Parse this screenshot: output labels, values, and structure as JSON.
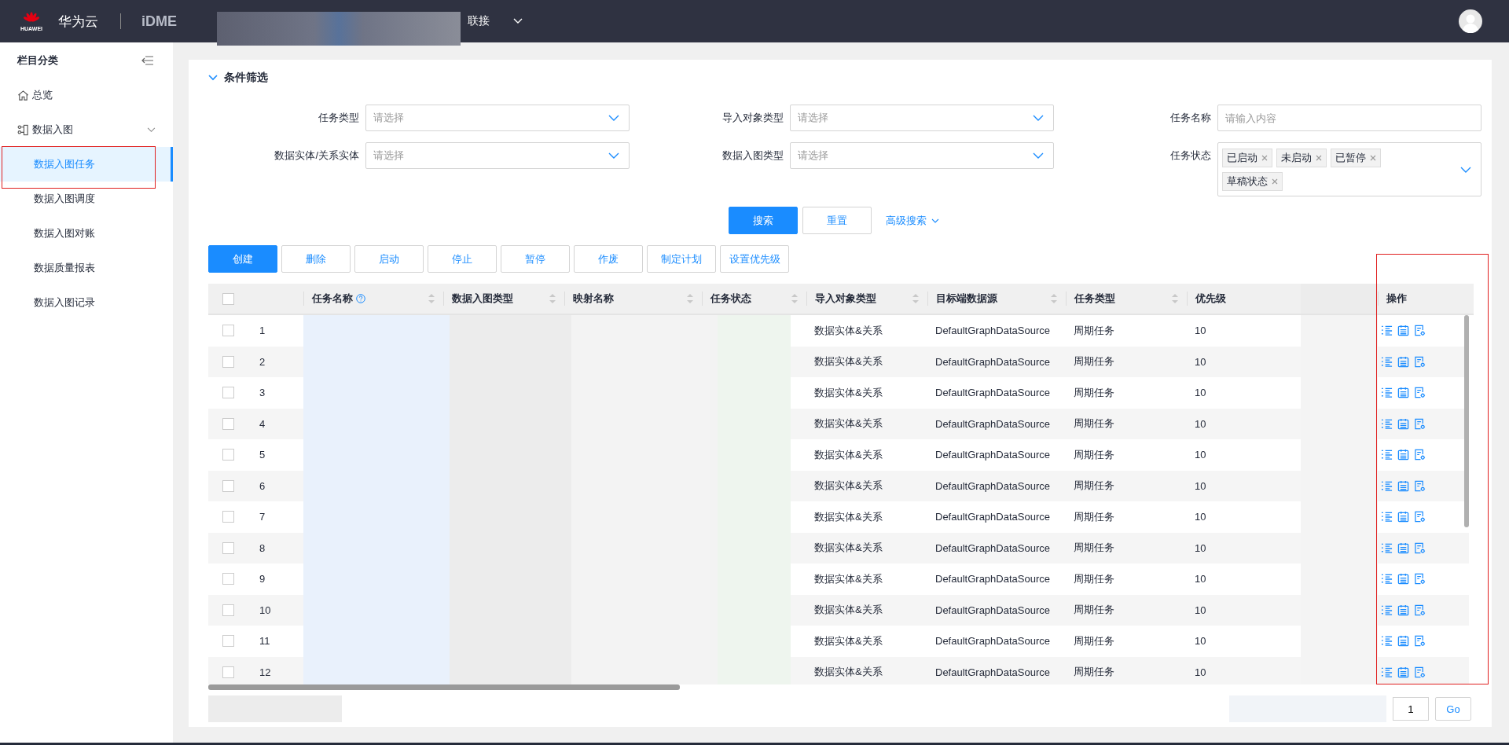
{
  "header": {
    "logo_text": "HUAWEI",
    "brand": "华为云",
    "product": "iDME",
    "project_suffix": "联接"
  },
  "sidebar": {
    "title": "栏目分类",
    "items": [
      {
        "label": "总览",
        "selected": false
      },
      {
        "label": "数据入图",
        "selected": false,
        "expanded": true,
        "children": [
          {
            "label": "数据入图任务",
            "selected": true
          },
          {
            "label": "数据入图调度",
            "selected": false
          },
          {
            "label": "数据入图对账",
            "selected": false
          },
          {
            "label": "数据质量报表",
            "selected": false
          },
          {
            "label": "数据入图记录",
            "selected": false
          }
        ]
      }
    ]
  },
  "filter": {
    "title": "条件筛选",
    "expanded": true,
    "fields": [
      {
        "label": "任务类型",
        "kind": "select",
        "placeholder": "请选择"
      },
      {
        "label": "导入对象类型",
        "kind": "select",
        "placeholder": "请选择"
      },
      {
        "label": "任务名称",
        "kind": "input",
        "placeholder": "请输入内容"
      },
      {
        "label": "数据实体/关系实体",
        "kind": "select",
        "placeholder": "请选择"
      },
      {
        "label": "数据入图类型",
        "kind": "select",
        "placeholder": "请选择"
      },
      {
        "label": "任务状态",
        "kind": "tags",
        "tags": [
          "已启动",
          "未启动",
          "已暂停",
          "草稿状态"
        ]
      }
    ],
    "search_button": "搜索",
    "reset_button": "重置",
    "advanced_link": "高级搜索"
  },
  "toolbar": [
    {
      "label": "创建",
      "primary": true
    },
    {
      "label": "删除",
      "primary": false
    },
    {
      "label": "启动",
      "primary": false
    },
    {
      "label": "停止",
      "primary": false
    },
    {
      "label": "暂停",
      "primary": false
    },
    {
      "label": "作废",
      "primary": false
    },
    {
      "label": "制定计划",
      "primary": false
    },
    {
      "label": "设置优先级",
      "primary": false
    }
  ],
  "table": {
    "all_checked": false,
    "columns": [
      {
        "label": "任务名称",
        "help": true,
        "sortable": true
      },
      {
        "label": "数据入图类型",
        "help": false,
        "sortable": true
      },
      {
        "label": "映射名称",
        "help": false,
        "sortable": true
      },
      {
        "label": "任务状态",
        "help": false,
        "sortable": true
      },
      {
        "label": "导入对象类型",
        "help": false,
        "sortable": true
      },
      {
        "label": "目标端数据源",
        "help": false,
        "sortable": true
      },
      {
        "label": "任务类型",
        "help": false,
        "sortable": true
      },
      {
        "label": "优先级",
        "help": false,
        "sortable": false
      },
      {
        "label": "操作",
        "help": false,
        "sortable": false
      }
    ],
    "rows": [
      {
        "index": "1",
        "checked": false,
        "import_type": "数据实体&关系",
        "datasource": "DefaultGraphDataSource",
        "task_type": "周期任务",
        "priority": "10"
      },
      {
        "index": "2",
        "checked": false,
        "import_type": "数据实体&关系",
        "datasource": "DefaultGraphDataSource",
        "task_type": "周期任务",
        "priority": "10"
      },
      {
        "index": "3",
        "checked": false,
        "import_type": "数据实体&关系",
        "datasource": "DefaultGraphDataSource",
        "task_type": "周期任务",
        "priority": "10"
      },
      {
        "index": "4",
        "checked": false,
        "import_type": "数据实体&关系",
        "datasource": "DefaultGraphDataSource",
        "task_type": "周期任务",
        "priority": "10"
      },
      {
        "index": "5",
        "checked": false,
        "import_type": "数据实体&关系",
        "datasource": "DefaultGraphDataSource",
        "task_type": "周期任务",
        "priority": "10"
      },
      {
        "index": "6",
        "checked": false,
        "import_type": "数据实体&关系",
        "datasource": "DefaultGraphDataSource",
        "task_type": "周期任务",
        "priority": "10"
      },
      {
        "index": "7",
        "checked": false,
        "import_type": "数据实体&关系",
        "datasource": "DefaultGraphDataSource",
        "task_type": "周期任务",
        "priority": "10"
      },
      {
        "index": "8",
        "checked": false,
        "import_type": "数据实体&关系",
        "datasource": "DefaultGraphDataSource",
        "task_type": "周期任务",
        "priority": "10"
      },
      {
        "index": "9",
        "checked": false,
        "import_type": "数据实体&关系",
        "datasource": "DefaultGraphDataSource",
        "task_type": "周期任务",
        "priority": "10"
      },
      {
        "index": "10",
        "checked": false,
        "import_type": "数据实体&关系",
        "datasource": "DefaultGraphDataSource",
        "task_type": "周期任务",
        "priority": "10"
      },
      {
        "index": "11",
        "checked": false,
        "import_type": "数据实体&关系",
        "datasource": "DefaultGraphDataSource",
        "task_type": "周期任务",
        "priority": "10"
      },
      {
        "index": "12",
        "checked": false,
        "import_type": "数据实体&关系",
        "datasource": "DefaultGraphDataSource",
        "task_type": "周期任务",
        "priority": "10"
      }
    ]
  },
  "pagination": {
    "page": "1",
    "go_button": "Go"
  }
}
